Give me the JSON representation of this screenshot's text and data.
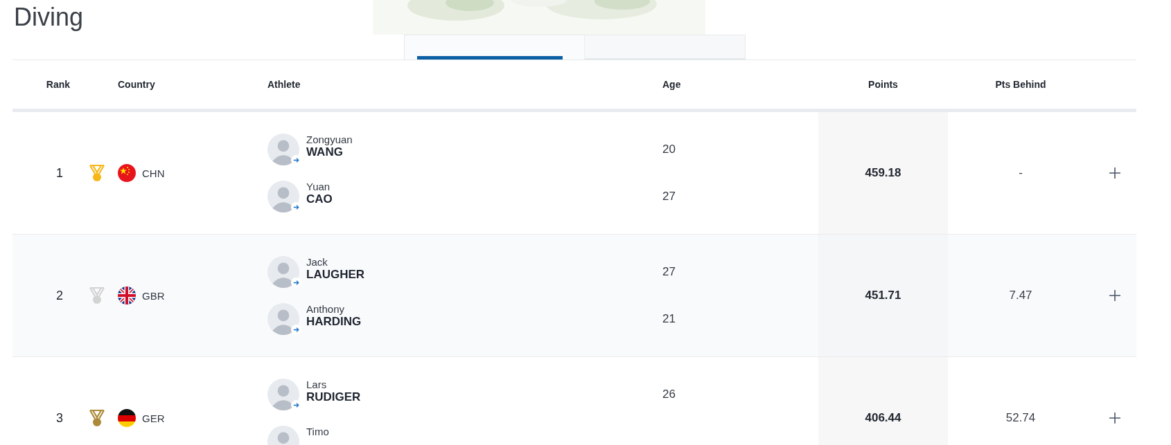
{
  "title": "Diving",
  "tabs": [
    {
      "selected": true
    },
    {
      "selected": false
    }
  ],
  "columns": [
    "Rank",
    "Country",
    "Athlete",
    "Age",
    "Points",
    "Pts Behind"
  ],
  "rows": [
    {
      "rank": "1",
      "color": "#f7b718",
      "kind": "china",
      "country": "CHN",
      "athletes": [
        {
          "first": "Zongyuan",
          "last": "WANG",
          "age": "20"
        },
        {
          "first": "Yuan",
          "last": "CAO",
          "age": "27"
        }
      ],
      "points": "459.18",
      "behind": "-"
    },
    {
      "rank": "2",
      "color": "#d3d3d3",
      "kind": "uk",
      "country": "GBR",
      "athletes": [
        {
          "first": "Jack",
          "last": "LAUGHER",
          "age": "27"
        },
        {
          "first": "Anthony",
          "last": "HARDING",
          "age": "21"
        }
      ],
      "points": "451.71",
      "behind": "7.47"
    },
    {
      "rank": "3",
      "color": "#ad8a3a",
      "kind": "germany",
      "country": "GER",
      "athletes": [
        {
          "first": "Lars",
          "last": "RUDIGER",
          "age": "26"
        },
        {
          "first": "Timo"
        }
      ],
      "points": "406.44",
      "behind": "52.74"
    }
  ]
}
